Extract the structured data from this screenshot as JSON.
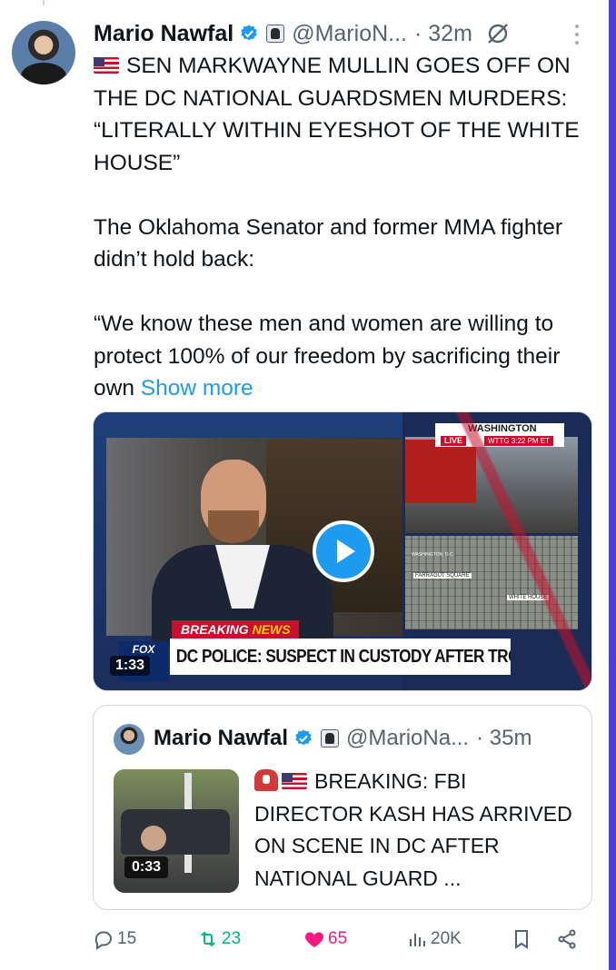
{
  "tweet": {
    "author_name": "Mario Nawfal",
    "author_handle": "@MarioN...",
    "time": "· 32m",
    "text_line1": "SEN MARKWAYNE MULLIN GOES OFF ON THE DC NATIONAL GUARDSMEN MURDERS: “LITERALLY WITHIN EYESHOT OF THE WHITE HOUSE”",
    "text_para2": "The Oklahoma Senator and former MMA fighter didn’t hold back:",
    "text_para3": "“We know these men and women are willing to protect 100% of our freedom by sacrificing their own",
    "show_more": "Show more",
    "icons": {
      "verified": "verified-badge-icon",
      "affiliate": "affiliate-badge-icon",
      "grok": "grok-icon",
      "more": "more-options-icon"
    },
    "accent_color": "#1d9bf0"
  },
  "media": {
    "duration": "1:33",
    "live_title": "WASHINGTON",
    "live_badge": "LIVE",
    "live_sub": "WTTG 3:22 PM ET",
    "breaking": "BREAKING",
    "breaking_news": "NEWS",
    "chyron": "DC POLICE: SUSPECT IN CUSTODY AFTER TROOPS SHOT",
    "fox_logo": "FOX",
    "map_label_1": "WASHINGTON, D.C.",
    "map_label_2": "FARRAGUT SQUARE",
    "map_label_3": "WHITE HOUSE"
  },
  "quoted": {
    "author_name": "Mario Nawfal",
    "author_handle": "@MarioNa...",
    "time": "· 35m",
    "duration": "0:33",
    "text": "BREAKING: FBI DIRECTOR KASH HAS ARRIVED ON SCENE IN DC AFTER NATIONAL GUARD ..."
  },
  "actions": {
    "replies": "15",
    "retweets": "23",
    "likes": "65",
    "views": "20K"
  }
}
